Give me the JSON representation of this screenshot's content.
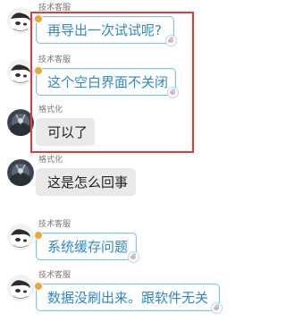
{
  "chat": {
    "messages": [
      {
        "sender": "技术客服",
        "text": "再导出一次试试呢?",
        "role": "agent"
      },
      {
        "sender": "技术客服",
        "text": "这个空白界面不关闭",
        "role": "agent"
      },
      {
        "sender": "格式化",
        "text": "可以了",
        "role": "user"
      },
      {
        "sender": "格式化",
        "text": "这是怎么回事",
        "role": "user"
      },
      {
        "sender": "技术客服",
        "text": "系统缓存问题",
        "role": "agent"
      },
      {
        "sender": "技术客服",
        "text": "数据没刷出来。跟软件无关",
        "role": "agent"
      }
    ]
  },
  "icons": {
    "agent_avatar": "cartoon-avatar-icon",
    "user_avatar": "dark-avatar-icon"
  },
  "colors": {
    "agent_text": "#2f87c9",
    "agent_border": "#7fc6e2",
    "user_bubble": "#e9e9e9",
    "highlight": "#e03c3c"
  }
}
